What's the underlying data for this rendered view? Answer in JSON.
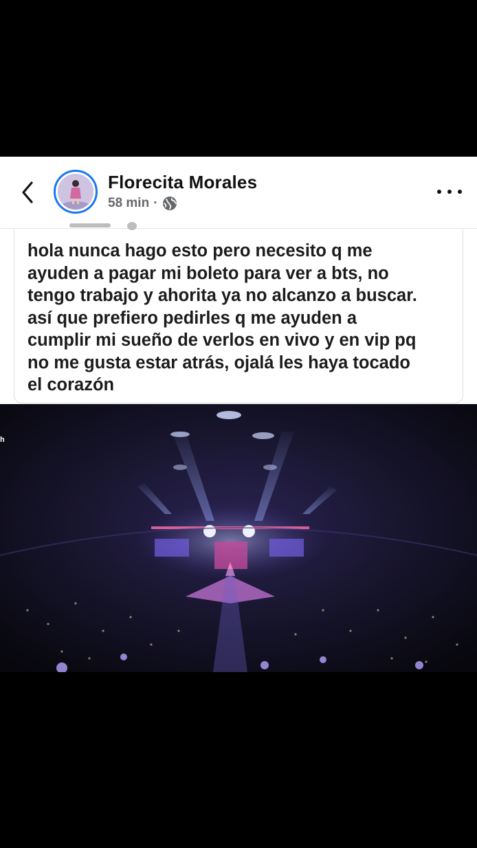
{
  "post": {
    "author_name": "Florecita Morales",
    "timestamp": "58 min",
    "separator": "·",
    "privacy_icon": "globe-icon",
    "text": "hola nunca hago esto pero necesito q me\nayuden a pagar mi boleto para ver a bts, no\ntengo trabajo y ahorita ya no alcanzo a buscar.\nasí que prefiero pedirles q me ayuden a\ncumplir mi sueño de verlos en vivo y en vip pq\nno me gusta estar atrás, ojalá les haya tocado\nel corazón"
  },
  "header": {
    "back_icon": "chevron-left-icon",
    "more_icon": "more-horizontal-icon"
  },
  "media": {
    "type": "concert-video-frame",
    "edge_glyph": "h"
  },
  "colors": {
    "accent": "#1877f2",
    "text": "#1c1c1c",
    "muted": "#65676b",
    "background": "#000000"
  }
}
